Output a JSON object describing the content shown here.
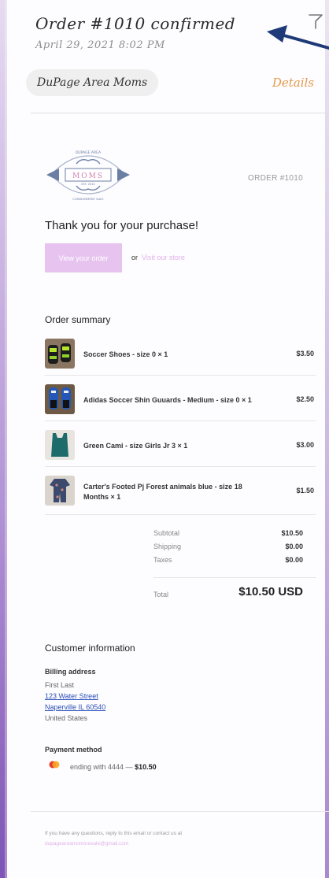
{
  "header": {
    "order_title": "Order #1010 confirmed",
    "date": "April 29, 2021 8:02 PM",
    "store_name": "DuPage Area Moms",
    "details_label": "Details"
  },
  "email": {
    "logo_text_top": "DUPAGE AREA",
    "logo_text_main": "MOMS",
    "logo_text_bottom": "CONSIGNMENT SALE",
    "logo_est": "EST. 2010",
    "order_number": "ORDER #1010",
    "thanks": "Thank you for your purchase!",
    "view_order_label": "View your order",
    "or_label": "or",
    "visit_store_label": "Visit our store",
    "summary_title": "Order summary",
    "items": [
      {
        "name": "Soccer Shoes - size 0 × 1",
        "price": "$3.50",
        "icon": "soccer-shoes-photo"
      },
      {
        "name": "Adidas Soccer Shin Guuards - Medium - size 0 × 1",
        "price": "$2.50",
        "icon": "shin-guards-photo"
      },
      {
        "name": "Green Cami - size Girls Jr 3 × 1",
        "price": "$3.00",
        "icon": "green-cami-photo"
      },
      {
        "name": "Carter's Footed Pj Forest animals blue - size 18 Months × 1",
        "price": "$1.50",
        "icon": "footed-pajamas-photo"
      }
    ],
    "totals": [
      {
        "label": "Subtotal",
        "value": "$10.50"
      },
      {
        "label": "Shipping",
        "value": "$0.00"
      },
      {
        "label": "Taxes",
        "value": "$0.00"
      }
    ],
    "total_label": "Total",
    "total_value": "$10.50 USD",
    "customer_title": "Customer information",
    "billing_title": "Billing address",
    "billing_name": "First Last",
    "billing_street": "123 Water Street",
    "billing_city": "Naperville IL 60540",
    "billing_country": "United States",
    "payment_title": "Payment method",
    "payment_text": "ending with 4444 —",
    "payment_amount": "$10.50",
    "footer_text": "If you have any questions, reply to this email or contact us at",
    "footer_email": "dupageareamomsresale@gmail.com"
  },
  "colors": {
    "accent_orange": "#e59a4a",
    "button_pink": "#e7c4ef",
    "link_blue": "#2b4fb8",
    "arrow_navy": "#1f3a78"
  }
}
